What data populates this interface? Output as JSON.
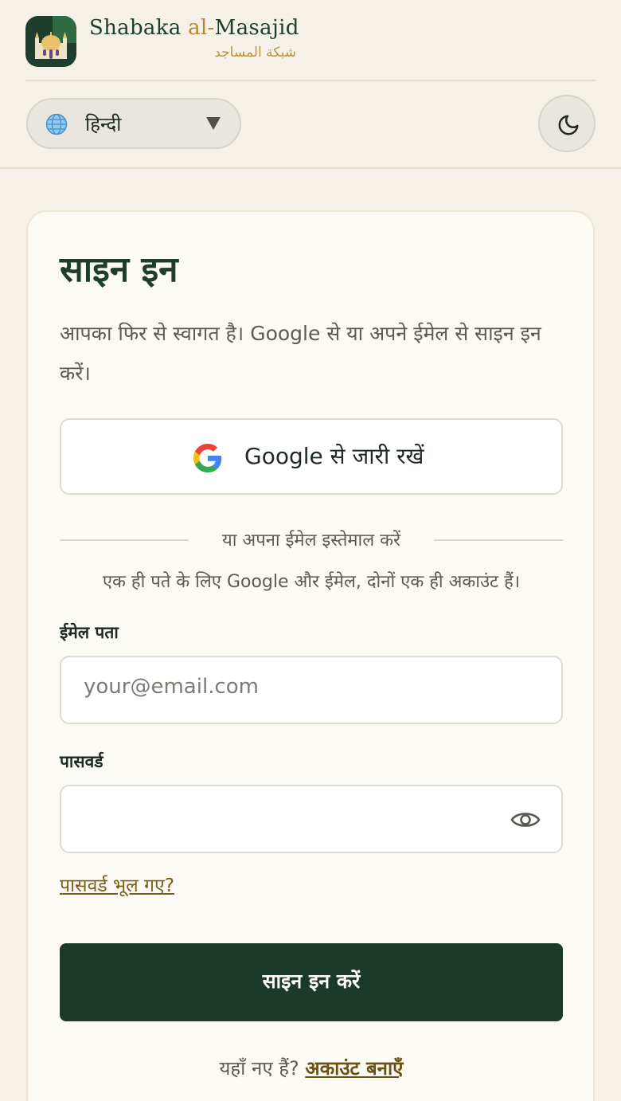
{
  "brand": {
    "name_prefix": "Shabaka ",
    "name_accent": "al-",
    "name_suffix": "Masajid",
    "arabic": "شبكة المساجد",
    "icon": "mosque-logo"
  },
  "toolbar": {
    "language": {
      "icon": "globe-icon",
      "selected": "हिन्दी"
    },
    "theme_toggle": {
      "icon": "moon-icon"
    }
  },
  "signin": {
    "title": "साइन इन",
    "subtitle": "आपका फिर से स्वागत है। Google से या अपने ईमेल से साइन इन करें।",
    "google_button": "Google से जारी रखें",
    "divider_text": "या अपना ईमेल इस्तेमाल करें",
    "note": "एक ही पते के लिए Google और ईमेल, दोनों एक ही अकाउंट हैं।",
    "email": {
      "label": "ईमेल पता",
      "placeholder": "your@email.com",
      "value": ""
    },
    "password": {
      "label": "पासवर्ड",
      "value": "",
      "toggle_icon": "eye-icon"
    },
    "forgot_link": "पासवर्ड भूल गए?",
    "submit": "साइन इन करें",
    "signup_prompt": "यहाँ नए हैं? ",
    "signup_link": "अकाउंट बनाएँ"
  },
  "colors": {
    "background": "#f5f1e8",
    "primary": "#1c3a29",
    "accent_gold": "#b08a2e",
    "link": "#7a5d16"
  }
}
